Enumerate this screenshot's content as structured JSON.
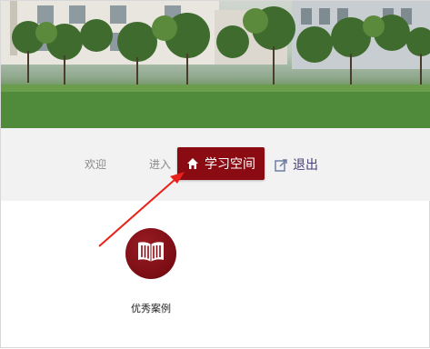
{
  "nav": {
    "welcome_label": "欢迎",
    "enter_label": "进入",
    "study_space_label": "学习空间",
    "logout_label": "退出"
  },
  "content": {
    "excellent_cases_label": "优秀案例"
  },
  "colors": {
    "accent": "#8b0b12",
    "nav_background": "#f2f2f2",
    "annotation_arrow": "#e8221b",
    "logout_text": "#4a3f7a"
  },
  "icons": [
    "home-icon",
    "exit-icon",
    "book-icon"
  ]
}
